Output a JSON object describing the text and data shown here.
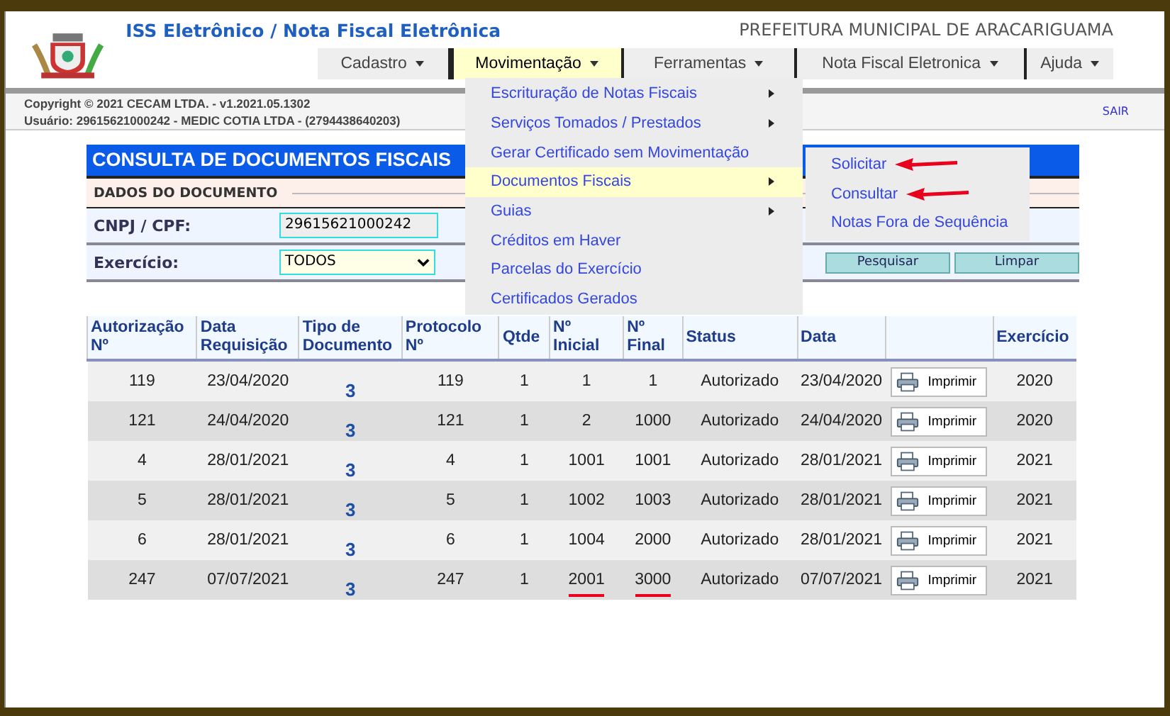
{
  "header": {
    "title": "ISS Eletrônico / Nota Fiscal Eletrônica",
    "municipality": "PREFEITURA MUNICIPAL DE ARACARIGUAMA"
  },
  "nav": [
    {
      "label": "Cadastro",
      "selected": false
    },
    {
      "label": "Movimentação",
      "selected": true
    },
    {
      "label": "Ferramentas",
      "selected": false
    },
    {
      "label": "Nota Fiscal Eletronica",
      "selected": false
    },
    {
      "label": "Ajuda",
      "selected": false
    }
  ],
  "info": {
    "copyright": "Copyright © 2021 CECAM LTDA. - v1.2021.05.1302",
    "user": "Usuário: 29615621000242 - MEDIC COTIA LTDA - (2794438640203)",
    "logout": "SAIR"
  },
  "menu": [
    {
      "label": "Escrituração de Notas Fiscais",
      "submenu": true,
      "selected": false
    },
    {
      "label": "Serviços Tomados / Prestados",
      "submenu": true,
      "selected": false
    },
    {
      "label": "Gerar Certificado sem Movimentação",
      "submenu": false,
      "selected": false
    },
    {
      "label": "Documentos Fiscais",
      "submenu": true,
      "selected": true
    },
    {
      "label": "Guias",
      "submenu": true,
      "selected": false
    },
    {
      "label": "Créditos em Haver",
      "submenu": false,
      "selected": false
    },
    {
      "label": "Parcelas do Exercício",
      "submenu": false,
      "selected": false
    },
    {
      "label": "Certificados Gerados",
      "submenu": false,
      "selected": false
    }
  ],
  "submenu": [
    {
      "label": "Solicitar",
      "marked": true
    },
    {
      "label": "Consultar",
      "marked": true
    },
    {
      "label": "Notas Fora de Sequência",
      "marked": false
    }
  ],
  "form": {
    "title": "CONSULTA DE DOCUMENTOS FISCAIS",
    "section": "DADOS DO DOCUMENTO",
    "cnpj_label": "CNPJ / CPF:",
    "cnpj_value": "29615621000242",
    "year_label": "Exercício:",
    "year_value": "TODOS",
    "search_button": "Pesquisar",
    "clear_button": "Limpar"
  },
  "table": {
    "columns": [
      "Autorização\nNº",
      "Data\nRequisição",
      "Tipo de\nDocumento",
      "Protocolo\nNº",
      "Qtde",
      "Nº\nInicial",
      "Nº\nFinal",
      "Status",
      "Data",
      "",
      "Exercício"
    ],
    "rows": [
      {
        "cells": [
          "119",
          "23/04/2020",
          "3",
          "119",
          "1",
          "1",
          "1",
          "Autorizado",
          "23/04/2020",
          "Imprimir",
          "2020"
        ],
        "underlined": false
      },
      {
        "cells": [
          "121",
          "24/04/2020",
          "3",
          "121",
          "1",
          "2",
          "1000",
          "Autorizado",
          "24/04/2020",
          "Imprimir",
          "2020"
        ],
        "underlined": false
      },
      {
        "cells": [
          "4",
          "28/01/2021",
          "3",
          "4",
          "1",
          "1001",
          "1001",
          "Autorizado",
          "28/01/2021",
          "Imprimir",
          "2021"
        ],
        "underlined": false
      },
      {
        "cells": [
          "5",
          "28/01/2021",
          "3",
          "5",
          "1",
          "1002",
          "1003",
          "Autorizado",
          "28/01/2021",
          "Imprimir",
          "2021"
        ],
        "underlined": false
      },
      {
        "cells": [
          "6",
          "28/01/2021",
          "3",
          "6",
          "1",
          "1004",
          "2000",
          "Autorizado",
          "28/01/2021",
          "Imprimir",
          "2021"
        ],
        "underlined": false
      },
      {
        "cells": [
          "247",
          "07/07/2021",
          "3",
          "247",
          "1",
          "2001",
          "3000",
          "Autorizado",
          "07/07/2021",
          "Imprimir",
          "2021"
        ],
        "underlined": true
      }
    ]
  }
}
